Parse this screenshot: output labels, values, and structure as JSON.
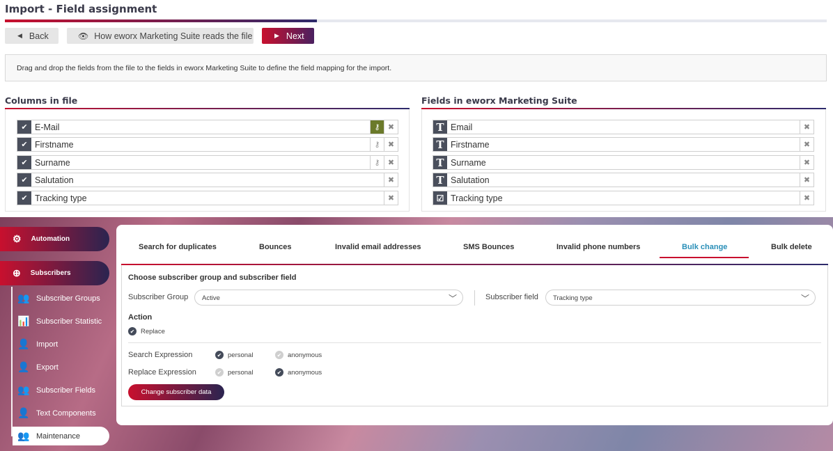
{
  "import": {
    "title": "Import - Field assignment",
    "progress_fraction": 0.38,
    "buttons": {
      "back": "Back",
      "reads_file": "How eworx Marketing Suite reads the file",
      "next": "Next"
    },
    "info_text": "Drag and drop the fields from the file to the fields in eworx Marketing Suite to define the field mapping for the import.",
    "columns_heading": "Columns in file",
    "fields_heading": "Fields in eworx Marketing Suite",
    "columns": [
      {
        "label": "E-Mail",
        "key": true,
        "key_active": true
      },
      {
        "label": "Firstname",
        "key": true,
        "key_active": false
      },
      {
        "label": "Surname",
        "key": true,
        "key_active": false
      },
      {
        "label": "Salutation",
        "key": false,
        "key_active": false
      },
      {
        "label": "Tracking type",
        "key": false,
        "key_active": false
      }
    ],
    "fields": [
      {
        "label": "Email",
        "icon": "text-type-icon"
      },
      {
        "label": "Firstname",
        "icon": "text-type-icon"
      },
      {
        "label": "Surname",
        "icon": "text-type-icon"
      },
      {
        "label": "Salutation",
        "icon": "text-type-icon"
      },
      {
        "label": "Tracking type",
        "icon": "checkbox-type-icon"
      }
    ]
  },
  "sidebar": {
    "automation": "Automation",
    "subscribers": "Subscribers",
    "items": [
      {
        "label": "Subscriber Groups",
        "icon": "users-group-icon"
      },
      {
        "label": "Subscriber Statistic",
        "icon": "statistic-icon"
      },
      {
        "label": "Import",
        "icon": "import-icon"
      },
      {
        "label": "Export",
        "icon": "export-icon"
      },
      {
        "label": "Subscriber Fields",
        "icon": "fields-icon"
      },
      {
        "label": "Text Components",
        "icon": "text-components-icon"
      },
      {
        "label": "Maintenance",
        "icon": "maintenance-icon"
      }
    ]
  },
  "maintenance": {
    "tabs": [
      "Search for duplicates",
      "Bounces",
      "Invalid email addresses",
      "SMS Bounces",
      "Invalid phone numbers",
      "Bulk change",
      "Bulk delete"
    ],
    "active_tab": "Bulk change",
    "section_title": "Choose subscriber group and subscriber field",
    "group_label": "Subscriber Group",
    "group_value": "Active",
    "field_label": "Subscriber field",
    "field_value": "Tracking type",
    "action_title": "Action",
    "action_option": "Replace",
    "search_label": "Search Expression",
    "replace_label": "Replace Expression",
    "opt_personal": "personal",
    "opt_anonymous": "anonymous",
    "change_button": "Change subscriber data"
  }
}
